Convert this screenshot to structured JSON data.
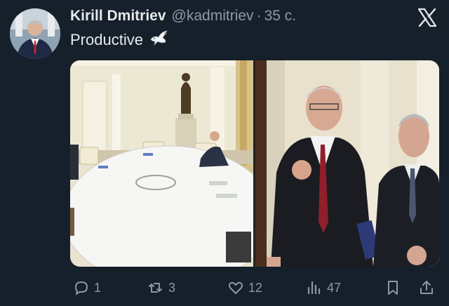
{
  "tweet": {
    "author_name": "Kirill Dmitriev",
    "handle": "@kadmitriev",
    "separator": "·",
    "time": "35 с.",
    "text": "Productive",
    "emoji_icon": "dove-icon"
  },
  "actions": {
    "replies": "1",
    "retweets": "3",
    "likes": "12",
    "views": "47"
  },
  "colors": {
    "background": "#15202b",
    "text": "#e7e9ea",
    "muted": "#8b98a5"
  }
}
